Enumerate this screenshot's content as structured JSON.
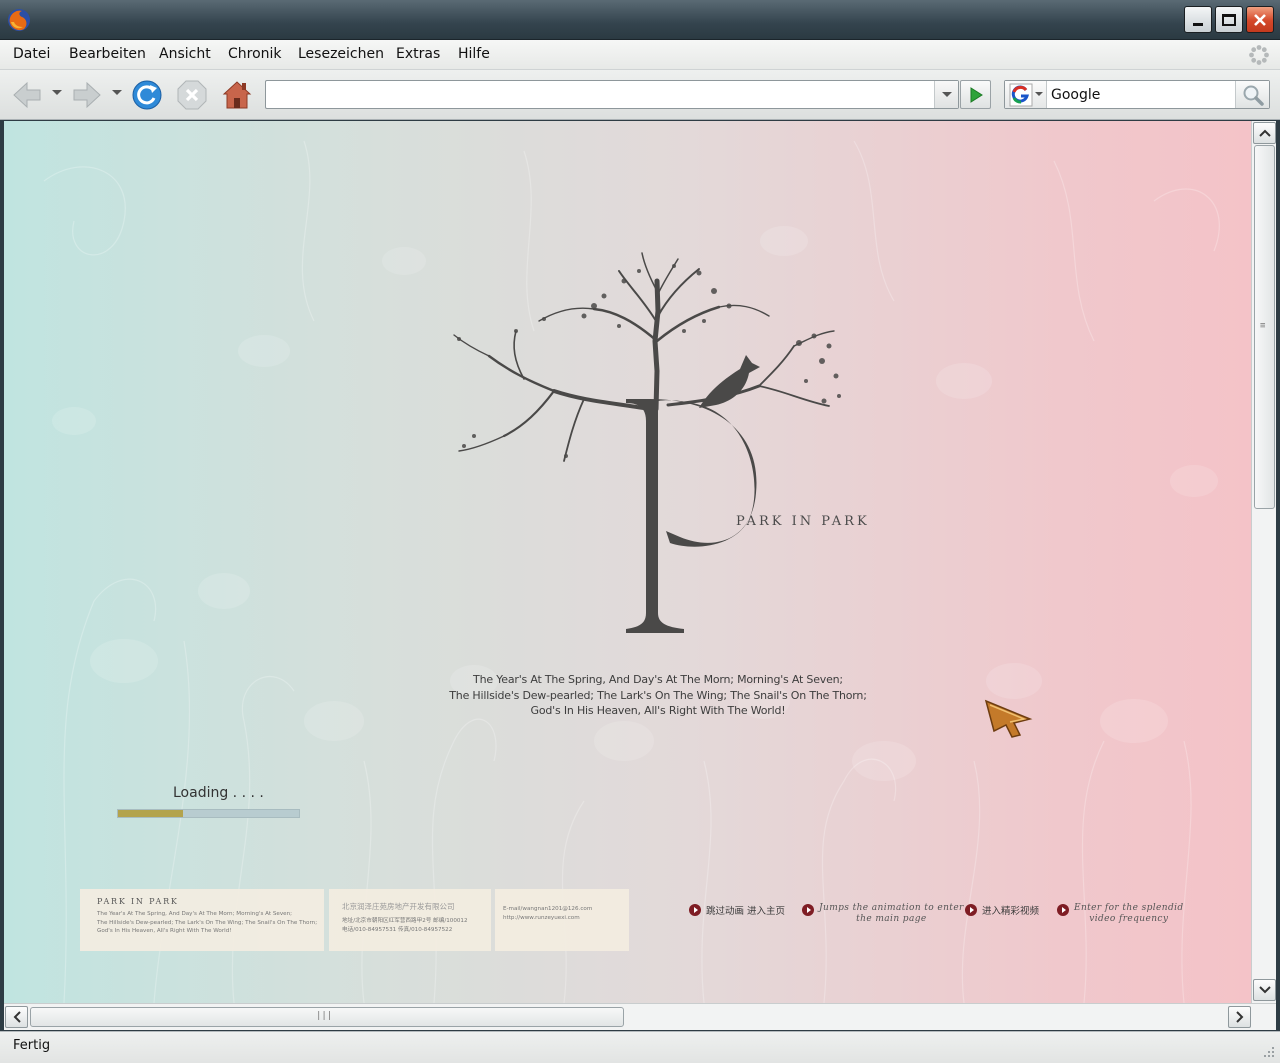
{
  "menubar": {
    "items": [
      "Datei",
      "Bearbeiten",
      "Ansicht",
      "Chronik",
      "Lesezeichen",
      "Extras",
      "Hilfe"
    ]
  },
  "navbar": {
    "url_value": "",
    "search_value": "Google",
    "search_engine_icon": "google-g-icon"
  },
  "page": {
    "brand": "PARK IN PARK",
    "poem": [
      "The Year's At The Spring, And Day's At The Morn; Morning's At Seven;",
      "The Hillside's Dew-pearled; The Lark's On The Wing; The Snail's On The Thorn;",
      "God's In His Heaven, All's Right With The World!"
    ],
    "loading": {
      "label": "Loading . . . .",
      "progress_percent": 36
    },
    "cards": {
      "one": {
        "title": "PARK IN PARK",
        "lines": [
          "The Year's At The Spring, And Day's At The Morn; Morning's At Seven;",
          "The Hillside's Dew-pearled; The Lark's On The Wing; The Snail's On The Thorn;",
          "God's In His Heaven, All's Right With The World!"
        ]
      },
      "two": {
        "company": "北京润泽庄苑房地产开发有限公司",
        "address": "地址/北京市朝阳区红军营西路甲2号  邮编/100012",
        "phone": "电话/010-84957531  传真/010-84957522"
      },
      "three": {
        "email": "E-mail/wangnan1201@126.com",
        "web": "http://www.runzeyuexi.com"
      }
    },
    "links": [
      {
        "cn": "跳过动画 进入主页"
      },
      {
        "en": [
          "Jumps the animation to enter",
          "the main page"
        ]
      },
      {
        "cn": "进入精彩视频"
      },
      {
        "en": [
          "Enter for the splendid",
          "video frequency"
        ]
      }
    ]
  },
  "statusbar": {
    "text": "Fertig"
  },
  "colors": {
    "accent_dark_red": "#7e1d24",
    "progress_fill": "#b3a34c",
    "bg_left": "#c0e4e0",
    "bg_right": "#f4c3c8"
  }
}
